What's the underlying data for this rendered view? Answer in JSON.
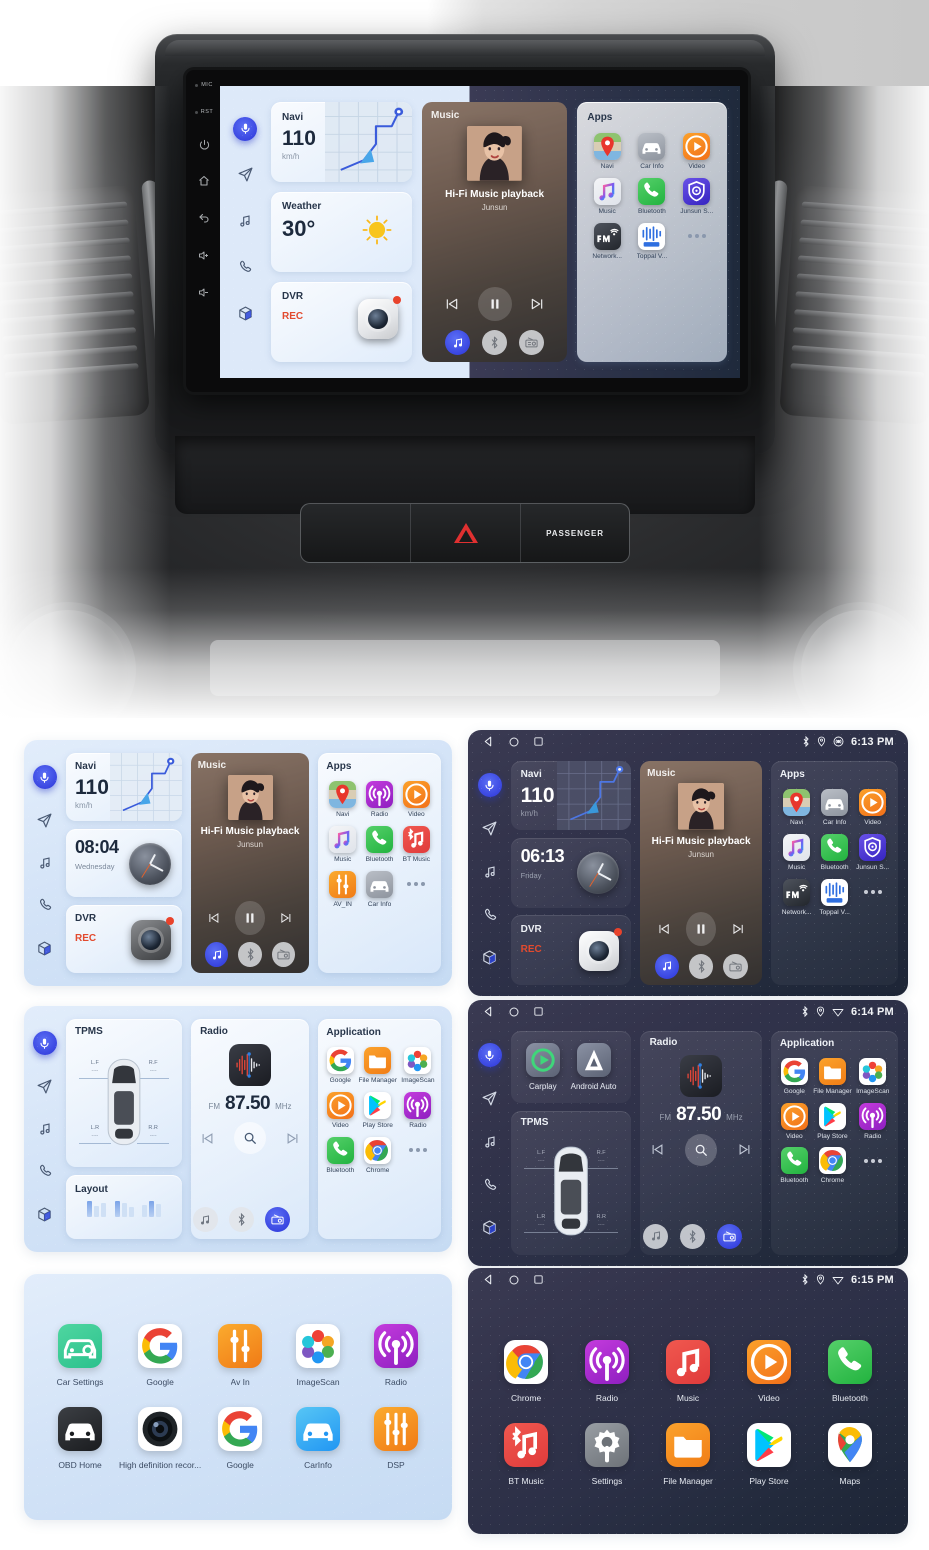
{
  "hero": {
    "bezel": {
      "labels": [
        "MIC",
        "RST"
      ],
      "keys": [
        "power-icon",
        "home-icon",
        "back-icon",
        "volume-up-icon",
        "volume-down-icon"
      ]
    },
    "dashboard": {
      "passenger_label": "PASSENGER",
      "hazard_label": "hazard-button"
    }
  },
  "sidebar": {
    "items": [
      {
        "name": "voice-assistant",
        "icon": "microphone-icon",
        "active": true
      },
      {
        "name": "navigation",
        "icon": "paper-plane-icon",
        "active": false
      },
      {
        "name": "music",
        "icon": "music-note-icon",
        "active": false
      },
      {
        "name": "phone",
        "icon": "phone-icon",
        "active": false
      },
      {
        "name": "apps",
        "icon": "cube-icon",
        "active": false
      }
    ]
  },
  "statusbar": {
    "nav": [
      "back-icon",
      "home-icon",
      "recents-icon"
    ],
    "icons": [
      "bluetooth-icon",
      "location-icon",
      "wifi-icon"
    ],
    "times": {
      "s2": "6:13 PM",
      "s4": "6:14 PM",
      "s6": "6:15 PM"
    }
  },
  "widgets": {
    "navi": {
      "title": "Navi",
      "value": "110",
      "unit": "km/h"
    },
    "weather": {
      "title": "Weather",
      "value": "30",
      "degree": "°"
    },
    "clock_light": {
      "time": "08:04",
      "day": "Wednesday"
    },
    "clock_dark": {
      "time": "06:13",
      "day": "Friday"
    },
    "dvr": {
      "title": "DVR",
      "status": "REC"
    },
    "music": {
      "title": "Music",
      "track": "Hi-Fi Music playback",
      "artist": "Junsun",
      "controls": [
        "prev-icon",
        "pause-icon",
        "next-icon"
      ],
      "sources": [
        "music-source-icon",
        "bluetooth-source-icon",
        "radio-source-icon"
      ]
    },
    "radio": {
      "title": "Radio",
      "band": "FM",
      "frequency": "87.50",
      "unit": "MHz",
      "controls": [
        "prev-icon",
        "search-icon",
        "next-icon"
      ],
      "sources": [
        "music-source-icon",
        "bluetooth-source-icon",
        "radio-source-icon"
      ]
    },
    "tpms": {
      "title": "TPMS",
      "wheels": [
        {
          "label": "L.F",
          "value": "----"
        },
        {
          "label": "R.F",
          "value": "----"
        },
        {
          "label": "L.R",
          "value": "----"
        },
        {
          "label": "R.R",
          "value": "----"
        }
      ]
    },
    "layout": {
      "title": "Layout"
    },
    "carplay": {
      "items": [
        {
          "label": "Carplay",
          "icon": "carplay-icon"
        },
        {
          "label": "Android Auto",
          "icon": "android-auto-icon"
        }
      ]
    }
  },
  "apps_panel": {
    "title_apps": "Apps",
    "title_application": "Application",
    "hero_grid": [
      {
        "label": "Navi",
        "icon": "navi-icon"
      },
      {
        "label": "Car Info",
        "icon": "car-info-icon"
      },
      {
        "label": "Video",
        "icon": "video-icon"
      },
      {
        "label": "Music",
        "icon": "music-icon"
      },
      {
        "label": "Bluetooth",
        "icon": "bluetooth-icon"
      },
      {
        "label": "Junsun S...",
        "icon": "junsun-icon"
      },
      {
        "label": "Network...",
        "icon": "fm-network-icon"
      },
      {
        "label": "Toppal V...",
        "icon": "toppal-icon"
      },
      {
        "label": "",
        "icon": "more-dots-icon"
      }
    ],
    "light_grid": [
      {
        "label": "Navi",
        "icon": "navi-icon"
      },
      {
        "label": "Radio",
        "icon": "radio-icon"
      },
      {
        "label": "Video",
        "icon": "video-icon"
      },
      {
        "label": "Music",
        "icon": "music-icon"
      },
      {
        "label": "Bluetooth",
        "icon": "bluetooth-icon"
      },
      {
        "label": "BT Music",
        "icon": "bt-music-icon"
      },
      {
        "label": "AV_IN",
        "icon": "av-in-icon"
      },
      {
        "label": "Car Info",
        "icon": "car-info-icon"
      },
      {
        "label": "",
        "icon": "more-dots-icon"
      }
    ],
    "application_grid": [
      {
        "label": "Google",
        "icon": "google-icon"
      },
      {
        "label": "File Manager",
        "icon": "file-manager-icon"
      },
      {
        "label": "ImageScan",
        "icon": "image-scan-icon"
      },
      {
        "label": "Video",
        "icon": "video-icon"
      },
      {
        "label": "Play Store",
        "icon": "play-store-icon"
      },
      {
        "label": "Radio",
        "icon": "radio-icon"
      },
      {
        "label": "Bluetooth",
        "icon": "bluetooth-icon"
      },
      {
        "label": "Chrome",
        "icon": "chrome-icon"
      },
      {
        "label": "",
        "icon": "more-dots-icon"
      }
    ]
  },
  "drawer_light": [
    {
      "label": "Car Settings",
      "icon": "car-settings-icon"
    },
    {
      "label": "Google",
      "icon": "google-icon"
    },
    {
      "label": "Av In",
      "icon": "av-in-icon"
    },
    {
      "label": "ImageScan",
      "icon": "image-scan-icon"
    },
    {
      "label": "Radio",
      "icon": "radio-icon"
    },
    {
      "label": "OBD Home",
      "icon": "obd-home-icon"
    },
    {
      "label": "High definition recor...",
      "icon": "hd-recorder-icon"
    },
    {
      "label": "Google",
      "icon": "google-icon"
    },
    {
      "label": "CarInfo",
      "icon": "car-info-blue-icon"
    },
    {
      "label": "DSP",
      "icon": "dsp-icon"
    }
  ],
  "drawer_dark": [
    {
      "label": "Chrome",
      "icon": "chrome-icon"
    },
    {
      "label": "Radio",
      "icon": "radio-icon"
    },
    {
      "label": "Music",
      "icon": "music-red-icon"
    },
    {
      "label": "Video",
      "icon": "video-icon"
    },
    {
      "label": "Bluetooth",
      "icon": "bluetooth-icon"
    },
    {
      "label": "BT Music",
      "icon": "bt-music-icon"
    },
    {
      "label": "Settings",
      "icon": "settings-icon"
    },
    {
      "label": "File Manager",
      "icon": "file-manager-icon"
    },
    {
      "label": "Play Store",
      "icon": "play-store-icon"
    },
    {
      "label": "Maps",
      "icon": "maps-icon"
    }
  ],
  "colors": {
    "accent_blue": "#2b34d8",
    "rec_red": "#e24a2e",
    "light_bg": "#d3e3f7",
    "dark_bg": "#32334b",
    "green": "#3ec25a",
    "orange": "#f5881f",
    "purple": "#b22fd0"
  }
}
